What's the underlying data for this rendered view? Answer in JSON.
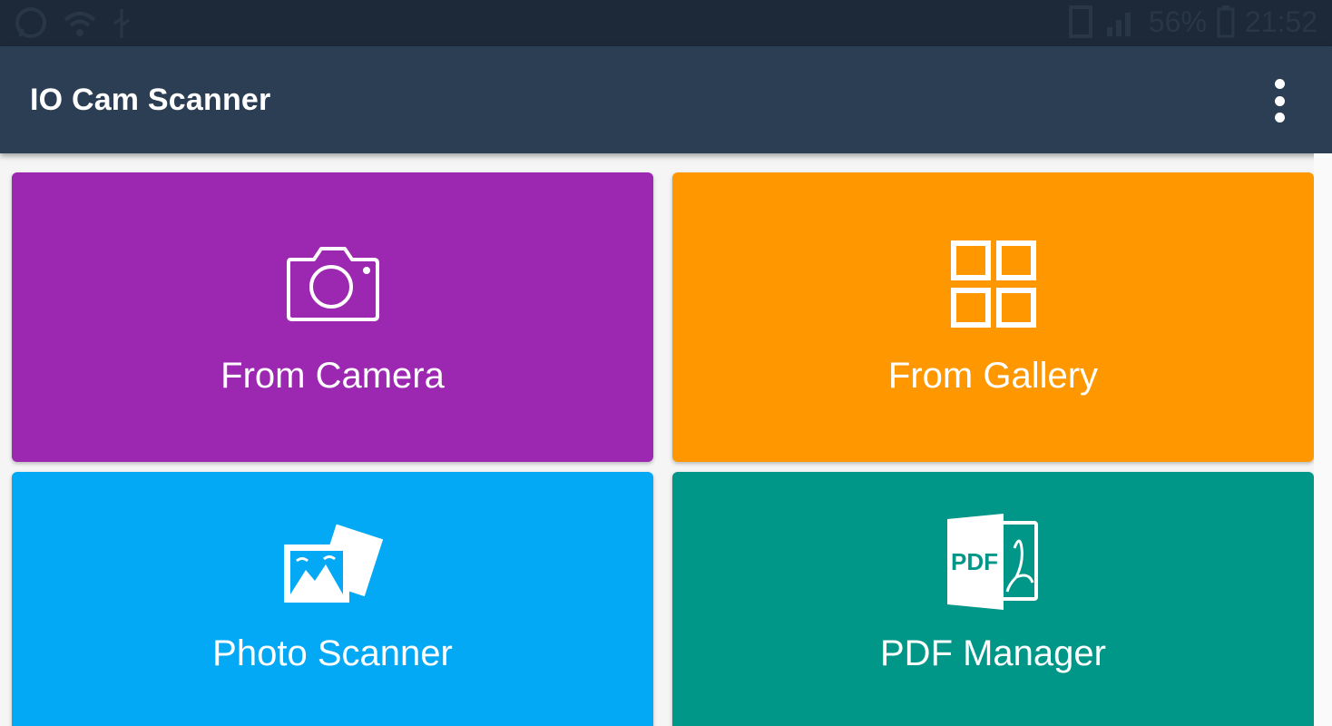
{
  "status_bar": {
    "battery_text": "56%",
    "time": "21:52",
    "icons": [
      "whatsapp-icon",
      "wifi-icon",
      "usb-icon",
      "sim-icon",
      "signal-icon",
      "battery-icon"
    ]
  },
  "app_bar": {
    "title": "IO Cam Scanner",
    "menu_icon": "more-vert-icon"
  },
  "tiles": [
    {
      "label": "From Camera",
      "color": "#9c27b0",
      "icon": "camera-icon"
    },
    {
      "label": "From Gallery",
      "color": "#ff9800",
      "icon": "grid-icon"
    },
    {
      "label": "Photo Scanner",
      "color": "#03a9f4",
      "icon": "photos-icon"
    },
    {
      "label": "PDF Manager",
      "color": "#009688",
      "icon": "pdf-file-icon"
    }
  ],
  "colors": {
    "status_bar": "#1d2938",
    "app_bar": "#2b3e54",
    "background": "#f5f5f5"
  }
}
